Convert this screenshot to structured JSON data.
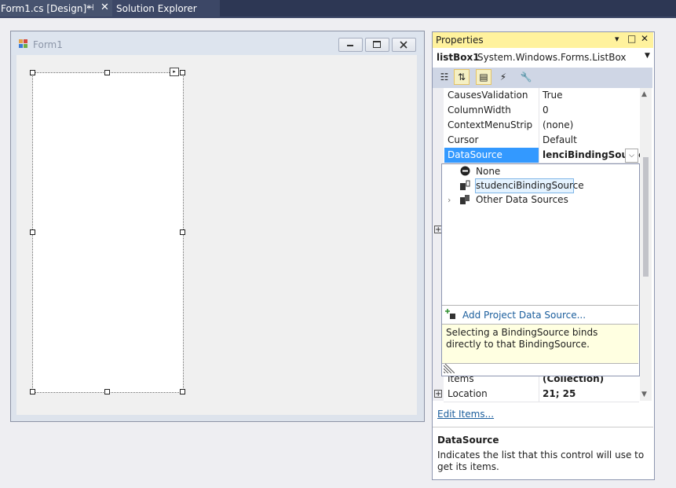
{
  "tabs": {
    "active": "Form1.cs [Design]*",
    "pin": "⊣",
    "close": "✕",
    "second": "Solution Explorer"
  },
  "form": {
    "title": "Form1"
  },
  "properties": {
    "title": "Properties",
    "title_buttons": [
      "▾",
      "□",
      "✕"
    ],
    "object_name": "listBox1",
    "object_type": "System.Windows.Forms.ListBox",
    "rows_top": [
      {
        "name": "CausesValidation",
        "value": "True"
      },
      {
        "name": "ColumnWidth",
        "value": "0"
      },
      {
        "name": "ContextMenuStrip",
        "value": "(none)"
      },
      {
        "name": "Cursor",
        "value": "Default"
      }
    ],
    "selected_row": {
      "name": "DataSource",
      "value": "lenciBindingSource"
    },
    "rows_bottom": [
      {
        "name": "Items",
        "value": "(Collection)"
      },
      {
        "name": "Location",
        "value": "21; 25"
      }
    ],
    "link": "Edit Items...",
    "desc_title": "DataSource",
    "desc_text": "Indicates the list that this control will use to get its items."
  },
  "dropdown": {
    "none": "None",
    "binding_source": "studenciBindingSource",
    "other": "Other Data Sources",
    "add": "Add Project Data Source...",
    "help": "Selecting a BindingSource binds directly to that BindingSource."
  },
  "colors": {
    "tab_bar": "#2d3754",
    "title_highlight": "#fff29d",
    "selection": "#3399ff",
    "link": "#1a5d9c",
    "help_bg": "#ffffe1"
  }
}
